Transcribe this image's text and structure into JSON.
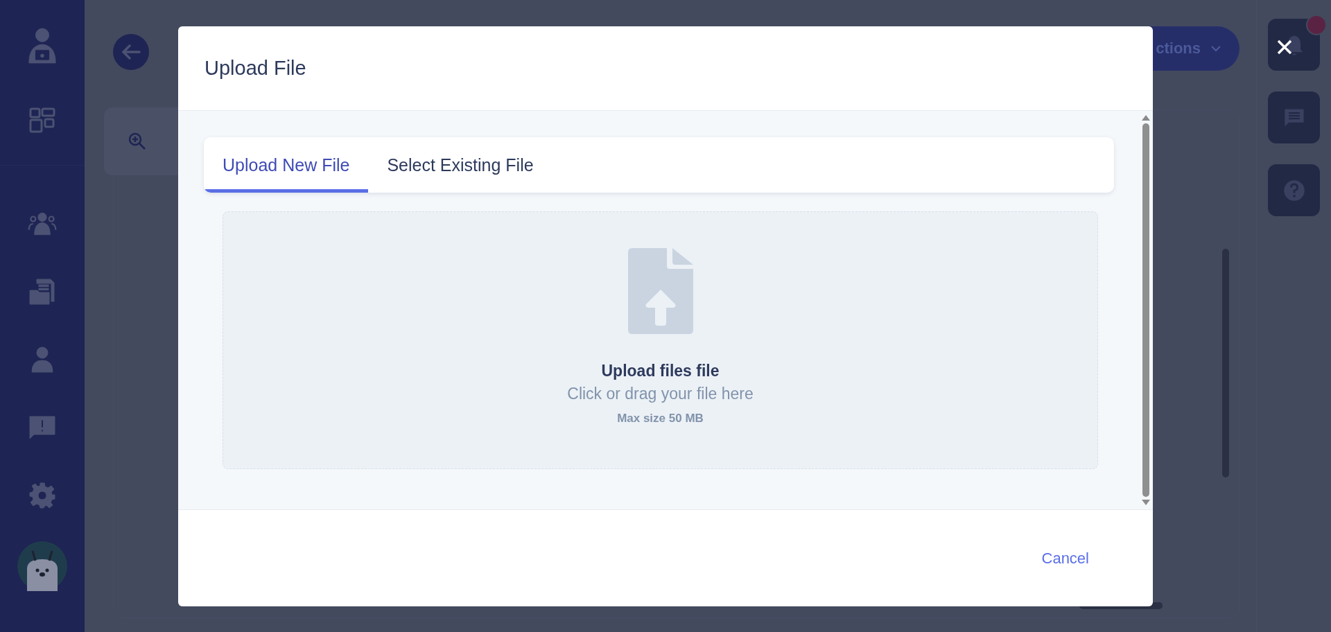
{
  "background": {
    "actions_button": "ctions"
  },
  "notifications": {
    "unread": true
  },
  "dialog": {
    "title": "Upload File",
    "tabs": [
      {
        "label": "Upload New File",
        "selected": true
      },
      {
        "label": "Select Existing File",
        "selected": false
      }
    ],
    "dropzone": {
      "title": "Upload files file",
      "hint": "Click or drag your file here",
      "limit": "Max size 50 MB"
    },
    "buttons": [
      "Cancel"
    ]
  }
}
